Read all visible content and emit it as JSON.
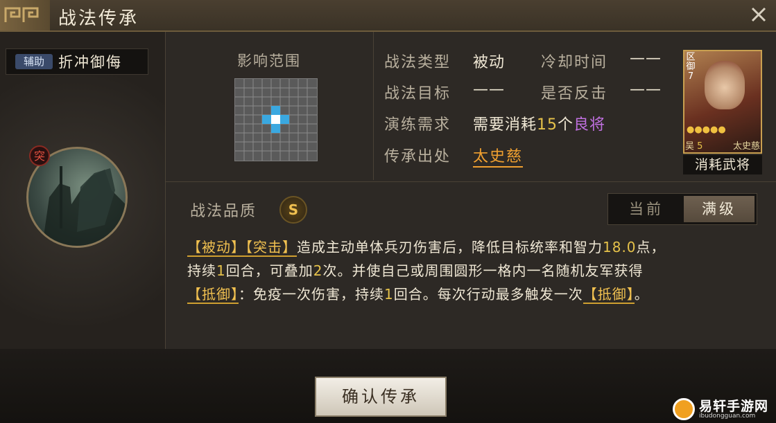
{
  "window": {
    "title": "战法传承"
  },
  "skill": {
    "type_tag": "辅助",
    "name": "折冲御侮",
    "icon_badge": "突",
    "quality_label": "战法品质",
    "quality_value": "S"
  },
  "range": {
    "label": "影响范围"
  },
  "info": {
    "type_label": "战法类型",
    "type_value": "被动",
    "cooldown_label": "冷却时间",
    "cooldown_value": "——",
    "target_label": "战法目标",
    "target_value": "——",
    "counter_label": "是否反击",
    "counter_value": "——",
    "drill_label": "演练需求",
    "drill_prefix": "需要消耗",
    "drill_count": "15",
    "drill_unit": "个",
    "drill_grade": "良将",
    "source_label": "传承出处",
    "source_value": "太史慈"
  },
  "card": {
    "tag_top": "区",
    "tag_mid": "御",
    "tag_num": "7",
    "stars": "●●●●●",
    "faction": "吴",
    "cost": "5",
    "hero_name": "太史慈",
    "caption": "消耗武将"
  },
  "toggle": {
    "current_label": "当前",
    "max_label": "满级"
  },
  "description": {
    "kw1": "【被动】",
    "kw2": "【突击】",
    "t1": "造成主动单体兵刃伤害后，降低目标统率和智力",
    "n1": "18.0",
    "t2": "点，",
    "t3": "持续",
    "n2": "1",
    "t4": "回合，可叠加",
    "n3": "2",
    "t5": "次。并使自己或周围圆形一格内一名随机友军获得",
    "kw3": "【抵御】",
    "t6": "：免疫一次伤害，持续",
    "n4": "1",
    "t7": "回合。每次行动最多触发一次",
    "kw4": "【抵御】",
    "t8": "。"
  },
  "actions": {
    "confirm_label": "确认传承"
  },
  "watermark": {
    "text": "易轩手游网",
    "sub": "ibudongguan.com"
  },
  "colors": {
    "accent_gold": "#f0c050",
    "grid_highlight": "#3aa8e0",
    "link_orange": "#f0a030"
  }
}
